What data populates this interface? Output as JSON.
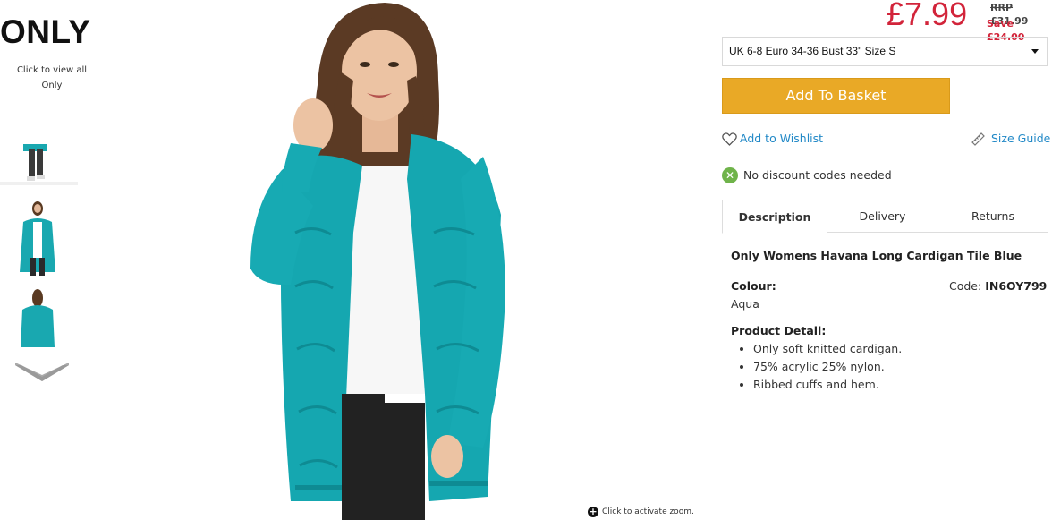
{
  "brand": {
    "logo_text": "ONLY",
    "view_all_line1": "Click to view all",
    "view_all_line2": "Only"
  },
  "gallery": {
    "thumbnails": [
      "thumb-lower-body",
      "thumb-front",
      "thumb-back"
    ],
    "up_icon": "chevron-up-icon",
    "down_icon": "chevron-down-icon",
    "zoom_hint": "Click to activate zoom.",
    "zoom_icon": "plus-circle-icon"
  },
  "pricing": {
    "price": "£7.99",
    "rrp": "RRP £31.99",
    "save": "Save £24.00",
    "price_color": "#d2243a"
  },
  "size_select": {
    "selected": "UK 6-8 Euro 34-36 Bust 33\" Size S"
  },
  "actions": {
    "basket_label": "Add To Basket",
    "basket_color": "#e9a926",
    "wishlist_label": "Add to Wishlist",
    "wishlist_icon": "heart-icon",
    "size_guide_label": "Size Guide",
    "size_guide_icon": "ruler-icon",
    "link_color": "#2289c7"
  },
  "discount": {
    "text": "No discount codes needed",
    "icon": "check-circle-icon"
  },
  "tabs": [
    {
      "label": "Description",
      "active": true
    },
    {
      "label": "Delivery",
      "active": false
    },
    {
      "label": "Returns",
      "active": false
    }
  ],
  "description": {
    "title": "Only Womens Havana Long Cardigan Tile Blue",
    "colour_label": "Colour:",
    "colour_value": "Aqua",
    "code_label": "Code:",
    "code_value": "IN6OY799",
    "detail_label": "Product Detail:",
    "details": [
      "Only soft knitted cardigan.",
      "75% acrylic 25% nylon.",
      "Ribbed cuffs and hem."
    ]
  }
}
